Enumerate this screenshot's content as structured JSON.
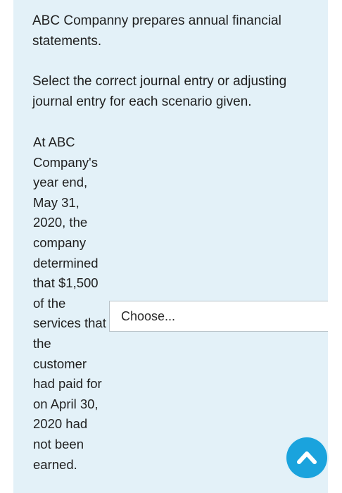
{
  "question": {
    "intro": "ABC Companny prepares annual financial statements.",
    "instruction": "Select the correct journal entry or adjusting journal entry for each scenario given.",
    "scenario_text": "At ABC Company's year end, May 31, 2020, the company determined that $1,500 of the services that the customer had paid for on April 30, 2020 had not been earned."
  },
  "answer_select": {
    "value": "Choose..."
  },
  "scroll_top_button": {
    "icon": "chevron-up-icon",
    "color": "#1aa3dd"
  },
  "colors": {
    "panel_background": "#e3f1f8",
    "text": "#1f1f1f"
  }
}
